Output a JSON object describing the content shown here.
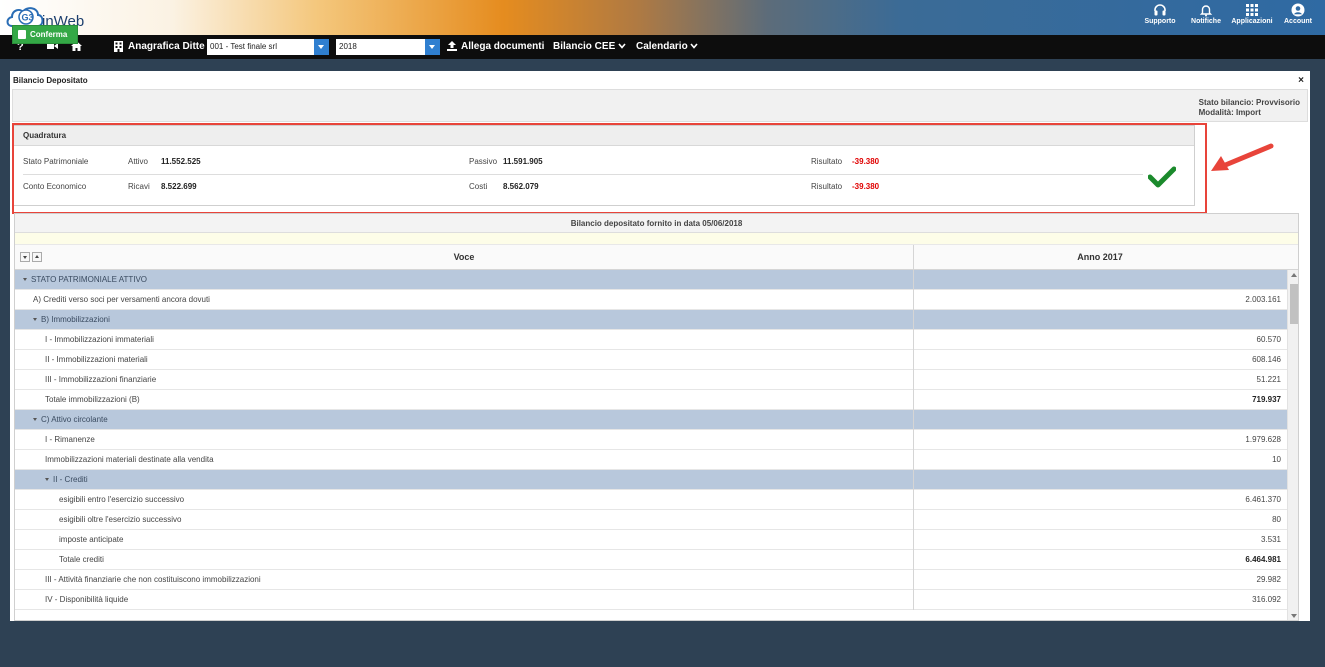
{
  "app": {
    "name": "inWeb",
    "badge": "G3"
  },
  "top_icons": [
    {
      "label": "Supporto",
      "icon": "headset-icon"
    },
    {
      "label": "Notifiche",
      "icon": "bell-icon"
    },
    {
      "label": "Applicazioni",
      "icon": "grid-icon"
    },
    {
      "label": "Account",
      "icon": "account-icon"
    }
  ],
  "menu": {
    "help": "?",
    "anagrafica": "Anagrafica Ditte",
    "company_select": "001 - Test finale srl",
    "year_select": "2018",
    "allega": "Allega documenti",
    "bilancio_cee": "Bilancio CEE",
    "calendario": "Calendario"
  },
  "panel": {
    "title": "Bilancio Depositato",
    "close": "×",
    "confirm_label": "Conferma",
    "stato": "Stato bilancio: Provvisorio",
    "modalita": "Modalità: Import"
  },
  "quadratura": {
    "title": "Quadratura",
    "rows": [
      {
        "name": "Stato Patrimoniale",
        "l1": "Attivo",
        "v1": "11.552.525",
        "l2": "Passivo",
        "v2": "11.591.905",
        "l3": "Risultato",
        "v3": "-39.380"
      },
      {
        "name": "Conto Economico",
        "l1": "Ricavi",
        "v1": "8.522.699",
        "l2": "Costi",
        "v2": "8.562.079",
        "l3": "Risultato",
        "v3": "-39.380"
      }
    ]
  },
  "grid": {
    "caption": "Bilancio depositato fornito in data 05/06/2018",
    "col_voce": "Voce",
    "col_anno": "Anno 2017",
    "rows": [
      {
        "label": "STATO PATRIMONIALE ATTIVO",
        "value": "",
        "group": true,
        "level": 0
      },
      {
        "label": "A) Crediti verso soci per versamenti ancora dovuti",
        "value": "2.003.161",
        "level": 1
      },
      {
        "label": "B) Immobilizzazioni",
        "value": "",
        "group": true,
        "level": 1
      },
      {
        "label": "I - Immobilizzazioni immateriali",
        "value": "60.570",
        "level": 2
      },
      {
        "label": "II - Immobilizzazioni materiali",
        "value": "608.146",
        "level": 2
      },
      {
        "label": "III - Immobilizzazioni finanziarie",
        "value": "51.221",
        "level": 2
      },
      {
        "label": "Totale immobilizzazioni (B)",
        "value": "719.937",
        "level": 2,
        "bold": true
      },
      {
        "label": "C) Attivo circolante",
        "value": "",
        "group": true,
        "level": 1
      },
      {
        "label": "I - Rimanenze",
        "value": "1.979.628",
        "level": 2
      },
      {
        "label": "Immobilizzazioni materiali destinate alla vendita",
        "value": "10",
        "level": 2
      },
      {
        "label": "II - Crediti",
        "value": "",
        "group": true,
        "level": 2
      },
      {
        "label": "esigibili entro l'esercizio successivo",
        "value": "6.461.370",
        "level": 3
      },
      {
        "label": "esigibili oltre l'esercizio successivo",
        "value": "80",
        "level": 3
      },
      {
        "label": "imposte anticipate",
        "value": "3.531",
        "level": 3
      },
      {
        "label": "Totale crediti",
        "value": "6.464.981",
        "level": 3,
        "bold": true
      },
      {
        "label": "III - Attività finanziarie che non costituiscono immobilizzazioni",
        "value": "29.982",
        "level": 2
      },
      {
        "label": "IV - Disponibilità liquide",
        "value": "316.092",
        "level": 2
      }
    ]
  }
}
